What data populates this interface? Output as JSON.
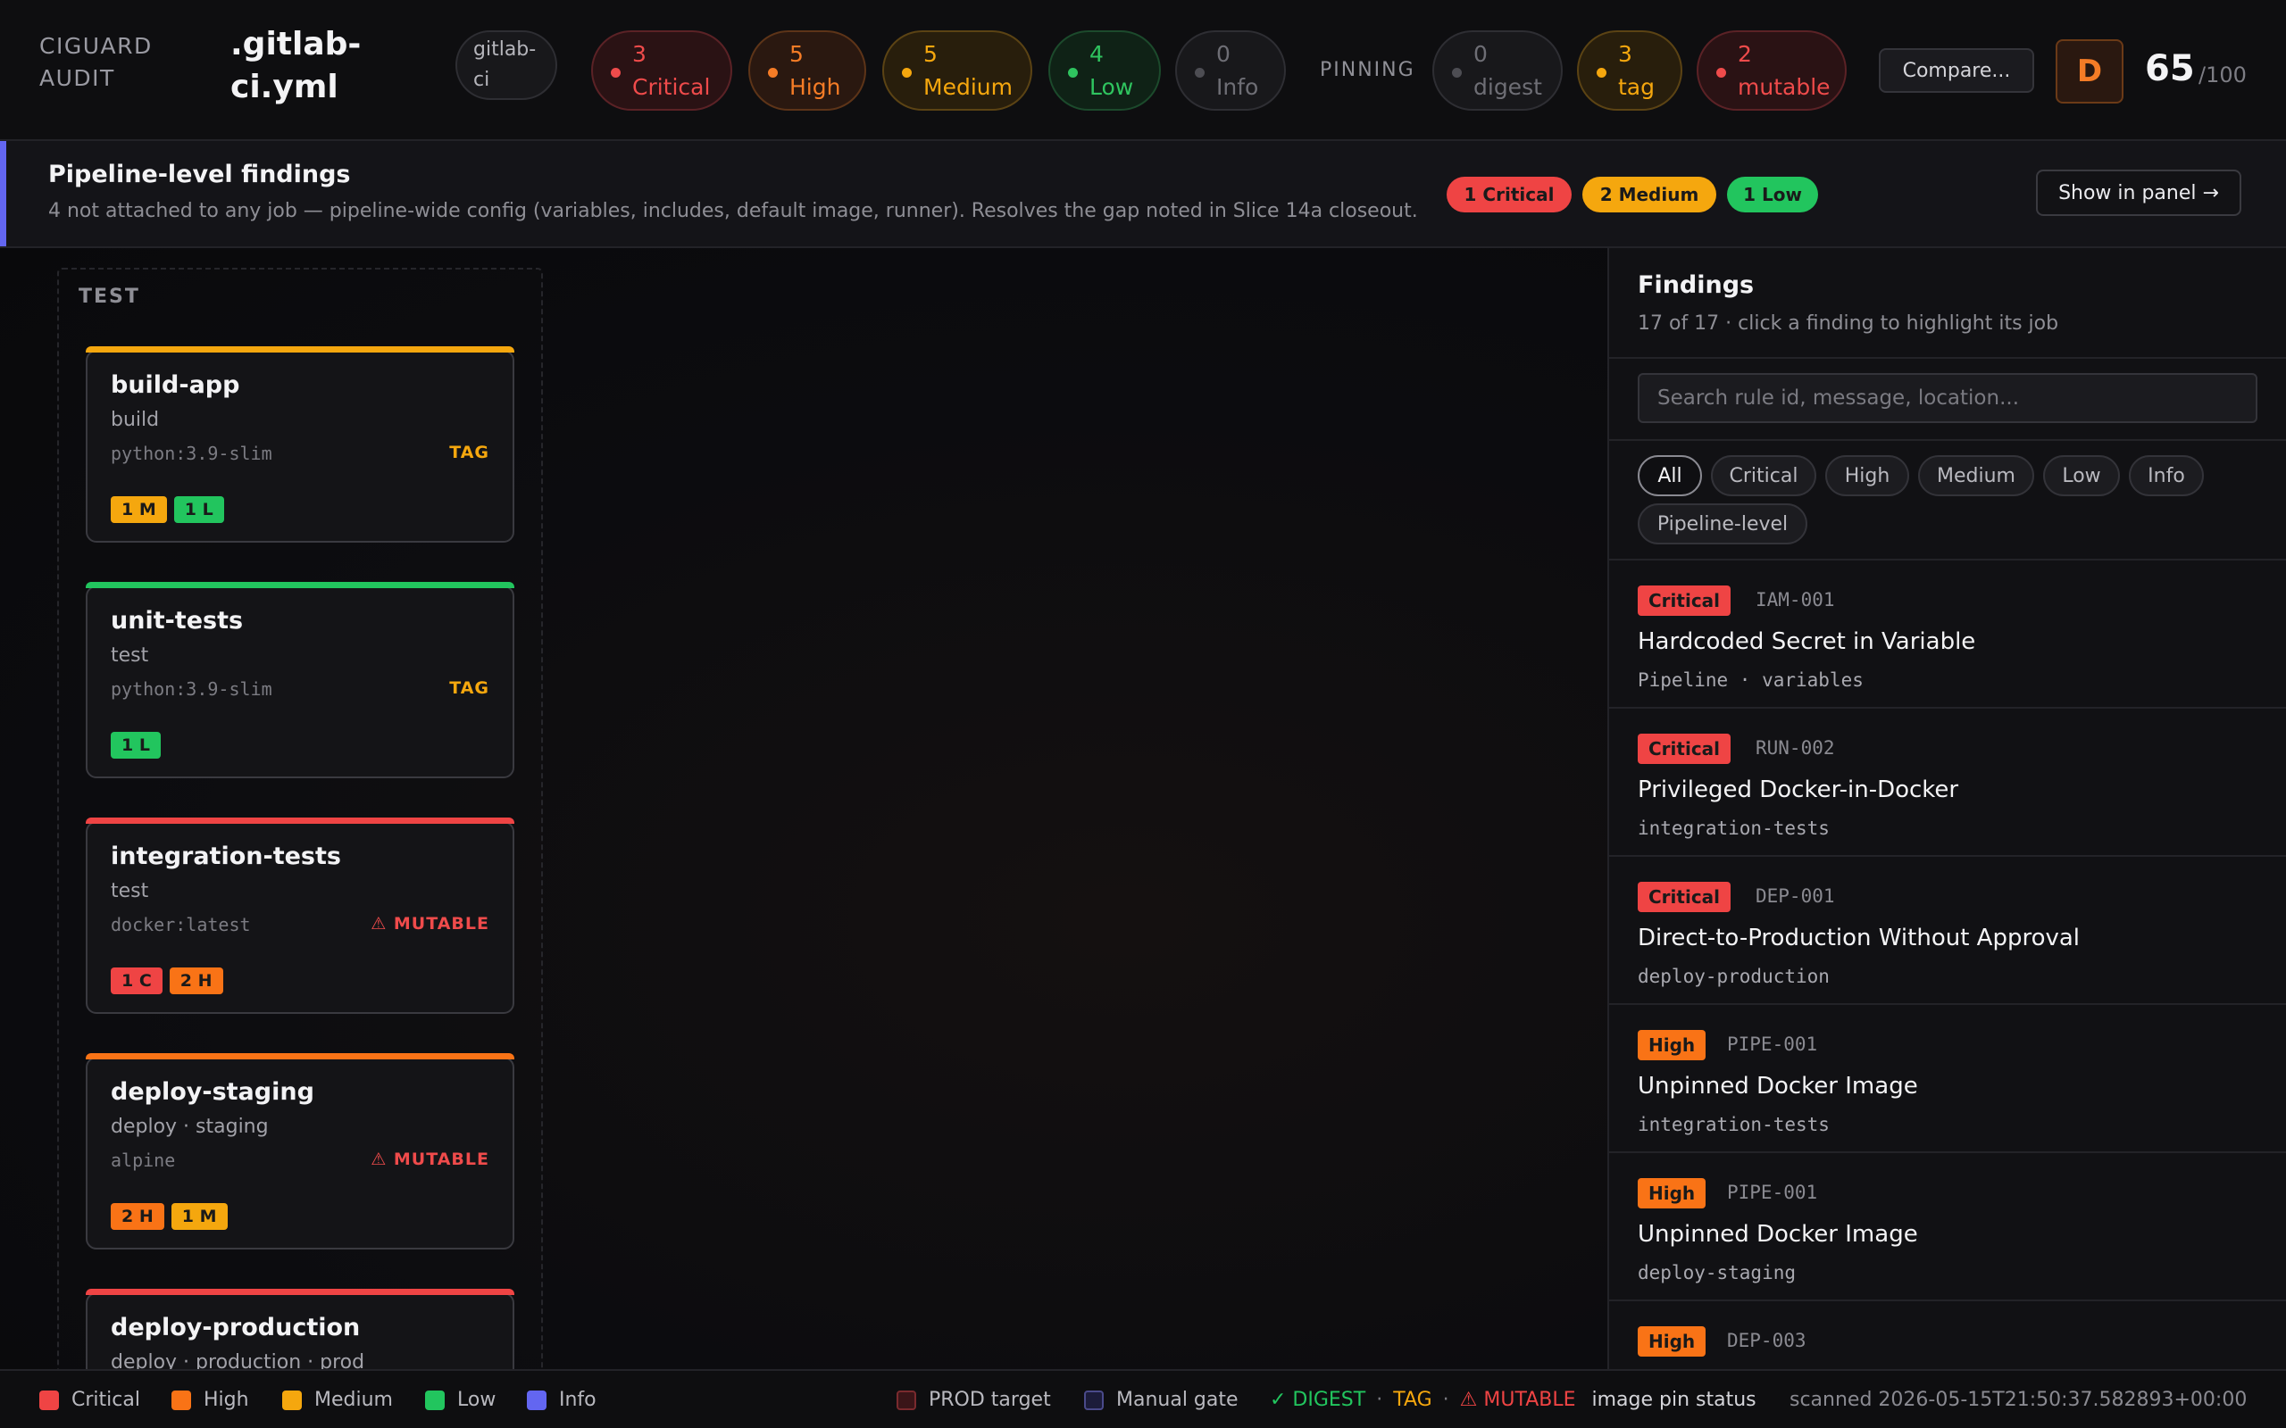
{
  "header": {
    "brand": "CIGUARD AUDIT",
    "file_title": ".gitlab-ci.yml",
    "platform": "gitlab-ci",
    "counts": {
      "critical": {
        "count": "3",
        "label": "Critical"
      },
      "high": {
        "count": "5",
        "label": "High"
      },
      "medium": {
        "count": "5",
        "label": "Medium"
      },
      "low": {
        "count": "4",
        "label": "Low"
      },
      "info": {
        "count": "0",
        "label": "Info"
      }
    },
    "pinning_label": "PINNING",
    "pinning": {
      "digest": {
        "count": "0",
        "label": "digest"
      },
      "tag": {
        "count": "3",
        "label": "tag"
      },
      "mutable": {
        "count": "2",
        "label": "mutable"
      }
    },
    "compare_label": "Compare...",
    "grade": "D",
    "score": "65",
    "score_max": "/100"
  },
  "banner": {
    "title": "Pipeline-level findings",
    "description": "4 not attached to any job — pipeline-wide config (variables, includes, default image, runner). Resolves the gap noted in Slice 14a closeout.",
    "chips": [
      "1 Critical",
      "2 Medium",
      "1 Low"
    ],
    "show_panel_label": "Show in panel →"
  },
  "stage": {
    "label": "TEST",
    "jobs": [
      {
        "name": "build-app",
        "stage": "build",
        "image": "python:3.9-slim",
        "pin": "TAG",
        "badges": [
          "1 M",
          "1 L"
        ]
      },
      {
        "name": "unit-tests",
        "stage": "test",
        "image": "python:3.9-slim",
        "pin": "TAG",
        "badges": [
          "1 L"
        ]
      },
      {
        "name": "integration-tests",
        "stage": "test",
        "image": "docker:latest",
        "pin": "⚠ MUTABLE",
        "badges": [
          "1 C",
          "2 H"
        ]
      },
      {
        "name": "deploy-staging",
        "stage": "deploy · staging",
        "image": "alpine",
        "pin": "⚠ MUTABLE",
        "badges": [
          "2 H",
          "1 M"
        ]
      },
      {
        "name": "deploy-production",
        "stage": "deploy · production · prod",
        "image": "",
        "pin": "",
        "badges": []
      }
    ]
  },
  "panel": {
    "title": "Findings",
    "subtitle": "17 of 17 · click a finding to highlight its job",
    "search_placeholder": "Search rule id, message, location...",
    "filters": [
      "All",
      "Critical",
      "High",
      "Medium",
      "Low",
      "Info",
      "Pipeline-level"
    ],
    "findings": [
      {
        "severity": "Critical",
        "rule": "IAM-001",
        "title": "Hardcoded Secret in Variable",
        "location": "Pipeline · variables"
      },
      {
        "severity": "Critical",
        "rule": "RUN-002",
        "title": "Privileged Docker-in-Docker",
        "location": "integration-tests"
      },
      {
        "severity": "Critical",
        "rule": "DEP-001",
        "title": "Direct-to-Production Without Approval",
        "location": "deploy-production"
      },
      {
        "severity": "High",
        "rule": "PIPE-001",
        "title": "Unpinned Docker Image",
        "location": "integration-tests"
      },
      {
        "severity": "High",
        "rule": "PIPE-001",
        "title": "Unpinned Docker Image",
        "location": "deploy-staging"
      },
      {
        "severity": "High",
        "rule": "DEP-003",
        "title": "",
        "location": ""
      }
    ]
  },
  "footer": {
    "legend": [
      "Critical",
      "High",
      "Medium",
      "Low",
      "Info"
    ],
    "prod_target": "PROD target",
    "manual_gate": "Manual gate",
    "pin_digest": "✓ DIGEST",
    "pin_tag": "TAG",
    "pin_mutable": "⚠ MUTABLE",
    "pin_separator": "·",
    "pin_status_label": "image pin status",
    "scanned": "scanned 2026-05-15T21:50:37.582893+00:00"
  },
  "colors": {
    "critical": "#ef4444",
    "high": "#f97316",
    "medium": "#f5a70e",
    "low": "#22c55e",
    "info": "#6366f1"
  }
}
